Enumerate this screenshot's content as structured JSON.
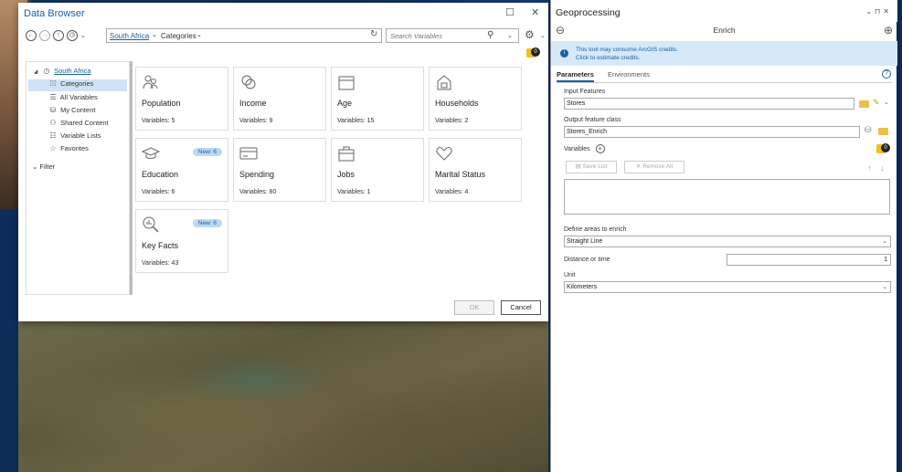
{
  "data_browser": {
    "title": "Data Browser",
    "minimize": "☐",
    "close": "✕",
    "breadcrumb_root": "South Africa",
    "breadcrumb_current": "Categories",
    "search_placeholder": "Search Variables",
    "badge_count": "0",
    "tree": {
      "root": "South Africa",
      "items": [
        "Categories",
        "All Variables",
        "My Content",
        "Shared Content",
        "Variable Lists",
        "Favorites"
      ],
      "filter": "Filter"
    },
    "cards": [
      {
        "title": "Population",
        "count": "Variables: 5",
        "badge": ""
      },
      {
        "title": "Income",
        "count": "Variables: 9",
        "badge": ""
      },
      {
        "title": "Age",
        "count": "Variables: 15",
        "badge": ""
      },
      {
        "title": "Households",
        "count": "Variables: 2",
        "badge": ""
      },
      {
        "title": "Education",
        "count": "Variables: 6",
        "badge": "New: 6"
      },
      {
        "title": "Spending",
        "count": "Variables: 80",
        "badge": ""
      },
      {
        "title": "Jobs",
        "count": "Variables: 1",
        "badge": ""
      },
      {
        "title": "Marital Status",
        "count": "Variables: 4",
        "badge": ""
      },
      {
        "title": "Key Facts",
        "count": "Variables: 43",
        "badge": "New: 6"
      }
    ],
    "ok_label": "OK",
    "cancel_label": "Cancel"
  },
  "geoprocessing": {
    "title": "Geoprocessing",
    "tool": "Enrich",
    "info_line1": "This tool may consume ArcGIS credits.",
    "info_line2": "Click to estimate credits.",
    "tab_parameters": "Parameters",
    "tab_environments": "Environments",
    "input_features_label": "Input Features",
    "input_features_value": "Stores",
    "output_label": "Output feature class",
    "output_value": "Stores_Enrich",
    "variables_label": "Variables",
    "variables_badge": "0",
    "save_list": "Save List",
    "remove_all": "Remove All",
    "define_areas_label": "Define areas to enrich",
    "define_areas_value": "Straight Line",
    "distance_label": "Distance or time",
    "distance_value": "1",
    "unit_label": "Unit",
    "unit_value": "Kilometers"
  },
  "colors": {
    "accent": "#1a5fa5",
    "selection": "#cfe3f7",
    "badge": "#f0c21c",
    "desktop": "#0d2d5c"
  }
}
